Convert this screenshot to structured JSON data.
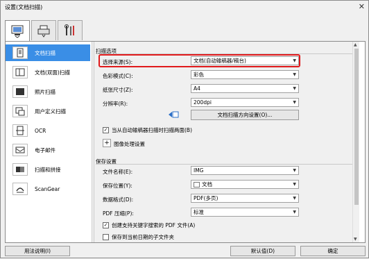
{
  "window": {
    "title": "设置(文档扫描)",
    "close": "✕"
  },
  "sidebar": {
    "items": [
      {
        "label": "文档扫描"
      },
      {
        "label": "文档(双面)扫描"
      },
      {
        "label": "照片扫描"
      },
      {
        "label": "用户定义扫描"
      },
      {
        "label": "OCR"
      },
      {
        "label": "电子邮件"
      },
      {
        "label": "扫描和拼接"
      },
      {
        "label": "ScanGear"
      }
    ]
  },
  "scan_options": {
    "heading": "扫描选项",
    "source_label": "选择来源(S):",
    "source_value": "文档(自动输稿器/稿台)",
    "color_label": "色彩模式(C):",
    "color_value": "彩色",
    "size_label": "纸张尺寸(Z):",
    "size_value": "A4",
    "res_label": "分辨率(R):",
    "res_value": "200dpi",
    "orient_button": "文档扫描方向设置(O)...",
    "adf_both_sides": "当从自动输稿器扫描时扫描两面(B)",
    "image_processing": "图像处理设置",
    "expand_symbol": "+"
  },
  "save_settings": {
    "heading": "保存设置",
    "filename_label": "文件名称(E):",
    "filename_value": "IMG",
    "location_label": "保存位置(Y):",
    "location_value": "文档",
    "format_label": "数据格式(D):",
    "format_value": "PDF(多页)",
    "compress_label": "PDF 压缩(P):",
    "compress_value": "标准",
    "keyword_pdf": "创建支持关键字搜索的 PDF 文件(A)",
    "date_subfolder": "保存到当前日期的子文件夹"
  },
  "footer": {
    "help": "用法说明(I)",
    "defaults": "默认值(D)",
    "ok": "确定"
  }
}
